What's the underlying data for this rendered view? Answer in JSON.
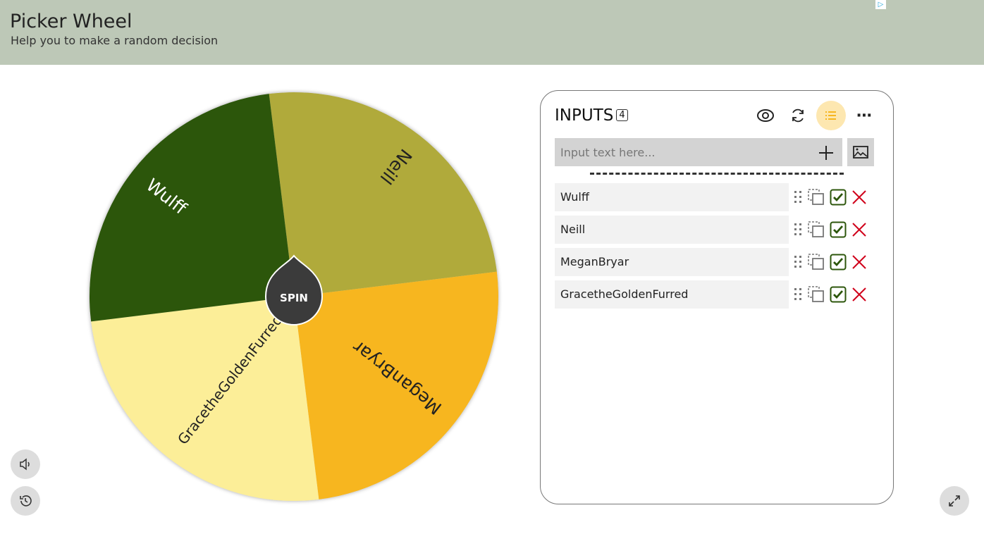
{
  "header": {
    "title": "Picker Wheel",
    "subtitle": "Help you to make a random decision"
  },
  "wheel": {
    "spin_label": "SPIN",
    "segments": [
      {
        "label": "Neill",
        "color": "#b0aa3b",
        "text_color": "#222"
      },
      {
        "label": "MeganBryar",
        "color": "#f7b61f",
        "text_color": "#222"
      },
      {
        "label": "GracetheGoldenFurred",
        "color": "#fcee98",
        "text_color": "#222"
      },
      {
        "label": "Wulff",
        "color": "#2c560b",
        "text_color": "#fff"
      }
    ]
  },
  "panel": {
    "title": "INPUTS",
    "count": "4",
    "placeholder": "Input text here...",
    "items": [
      {
        "label": "Wulff"
      },
      {
        "label": "Neill"
      },
      {
        "label": "MeganBryar"
      },
      {
        "label": "GracetheGoldenFurred"
      }
    ]
  },
  "colors": {
    "accent": "#fde7b0",
    "check": "#2c560b",
    "delete": "#d0021b"
  }
}
